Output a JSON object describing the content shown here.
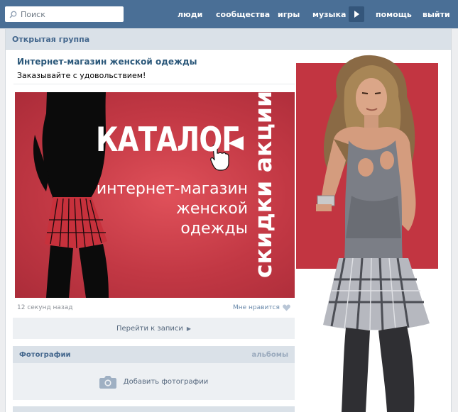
{
  "search": {
    "placeholder": "Поиск"
  },
  "topnav": {
    "items": [
      {
        "label": "люди"
      },
      {
        "label": "сообщества"
      },
      {
        "label": "игры"
      },
      {
        "label": "музыка"
      },
      {
        "label": "помощь"
      },
      {
        "label": "выйти"
      }
    ]
  },
  "page": {
    "header": "Открытая группа",
    "group_name": "Интернет-магазин женской одежды",
    "status": "Заказывайте с удовольствием!"
  },
  "banner": {
    "catalog": "КАТАЛОГ",
    "line1": "интернет-магазин",
    "line2": "женской",
    "line3": "одежды",
    "vertical": "скидки акции"
  },
  "post": {
    "time": "12 секунд назад",
    "like": "Мне нравится",
    "goto": "Перейти к записи"
  },
  "photos": {
    "title": "Фотографии",
    "albums": "альбомы",
    "add": "Добавить фотографии"
  },
  "colors": {
    "topbar": "#4a6f96",
    "banner_red": "#c23844",
    "link": "#2b587a"
  }
}
